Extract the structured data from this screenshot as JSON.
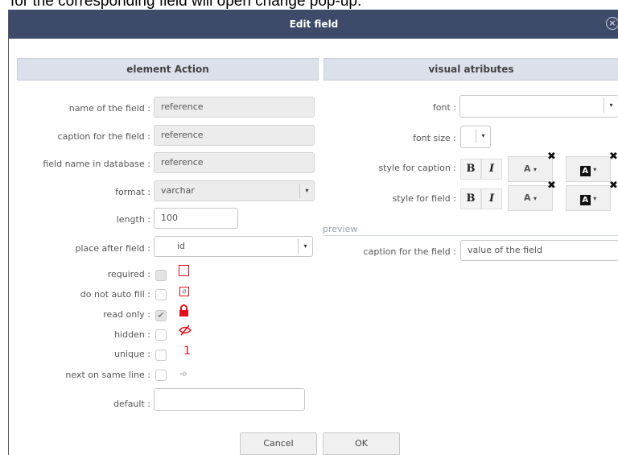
{
  "top_caption": "for the corresponding field will open change pop-up.",
  "dialog": {
    "title": "Edit field",
    "close_glyph": "×"
  },
  "left": {
    "header": "element Action",
    "fields": {
      "name_label": "name of the field :",
      "name_value": "reference",
      "caption_label": "caption for the field :",
      "caption_value": "reference",
      "dbname_label": "field name in database :",
      "dbname_value": "reference",
      "format_label": "format :",
      "format_value": "varchar",
      "length_label": "length :",
      "length_value": "100",
      "after_label": "place after field :",
      "after_value": "id",
      "required_label": "required :",
      "noautofill_label": "do not auto fill :",
      "readonly_label": "read only :",
      "hidden_label": "hidden :",
      "unique_label": "unique :",
      "unique_icon": "1",
      "nextline_label": "next on same line :",
      "default_label": "default :",
      "default_value": ""
    },
    "checkmark": "✔"
  },
  "right": {
    "header": "visual atributes",
    "font_label": "font :",
    "font_value": "",
    "fontsize_label": "font size :",
    "fontsize_value": "",
    "style_caption_label": "style for caption :",
    "style_field_label": "style for field :",
    "bold_glyph": "B",
    "italic_glyph": "I",
    "fg_letter": "A",
    "bg_letter": "A",
    "caret": "▾",
    "remove_glyph": "✖",
    "preview_title": "preview",
    "preview_caption": "caption for the field :",
    "preview_value": "value of the field"
  },
  "buttons": {
    "cancel": "Cancel",
    "ok": "OK"
  },
  "colors": {
    "titlebar": "#3d4a69",
    "section_header": "#dbe0ea",
    "icon_red": "#e0101c"
  }
}
